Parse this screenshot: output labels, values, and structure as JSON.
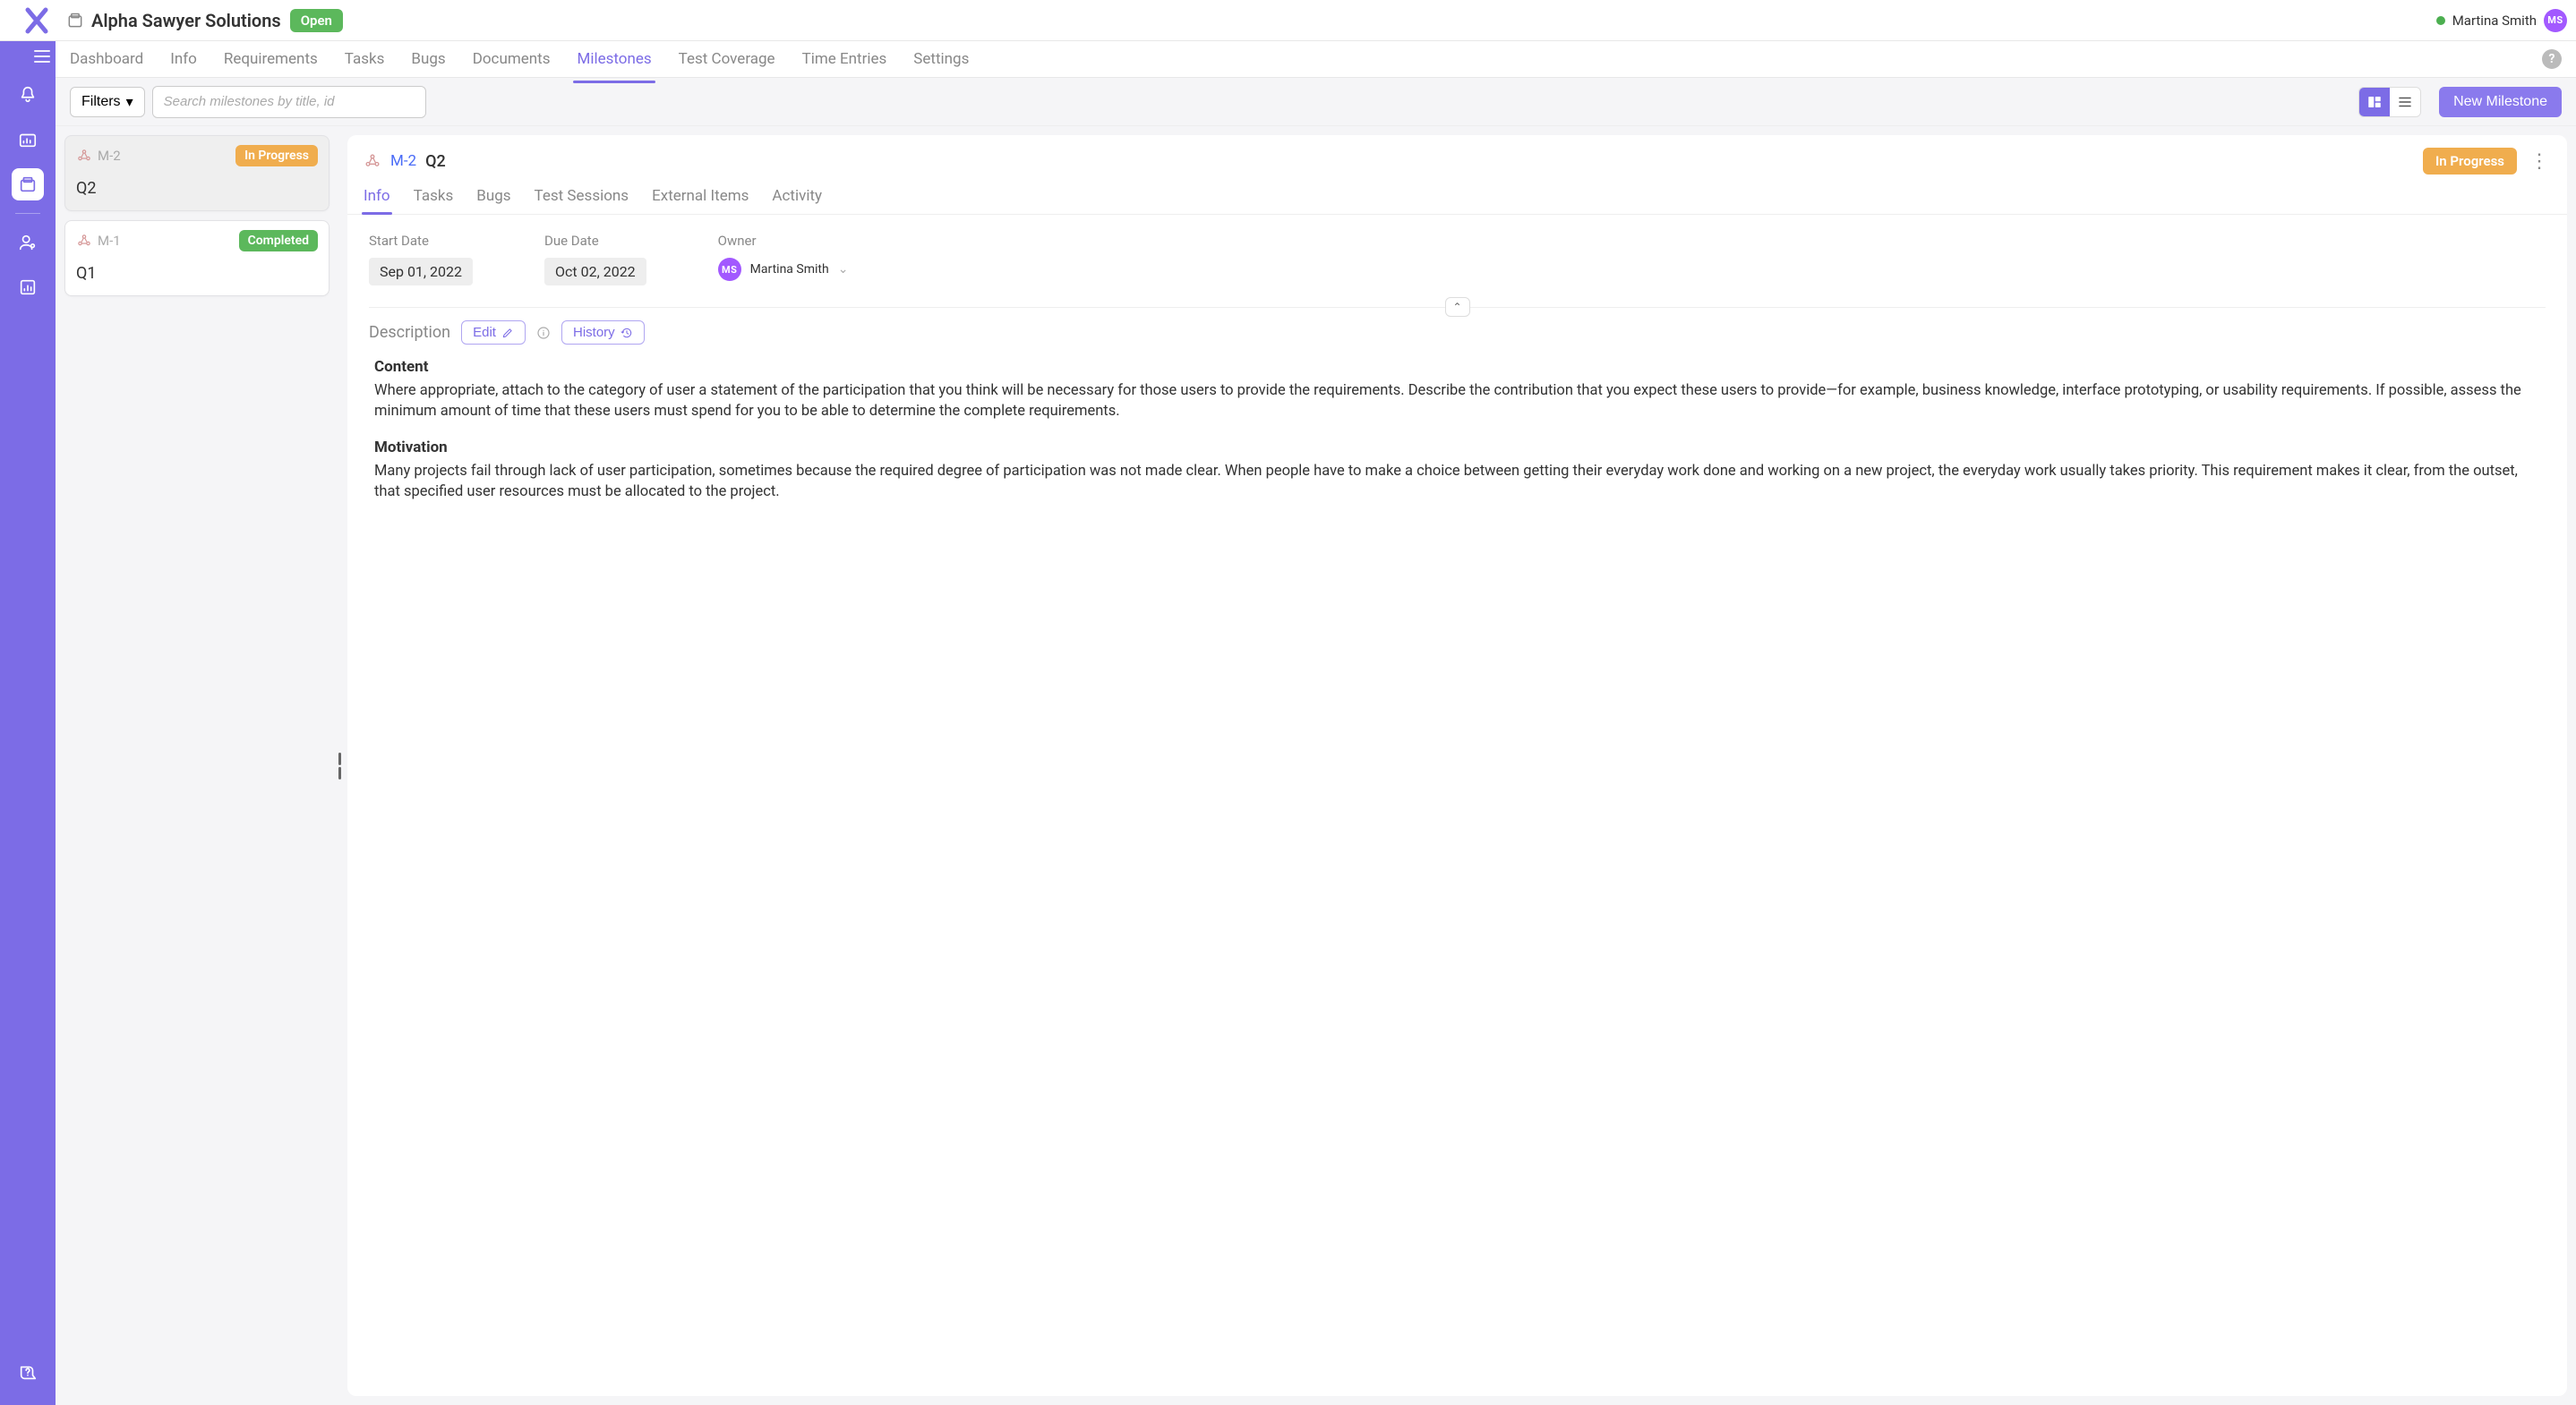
{
  "header": {
    "project_name": "Alpha Sawyer Solutions",
    "project_status": "Open",
    "user_name": "Martina Smith",
    "user_initials": "MS"
  },
  "main_tabs": {
    "items": [
      "Dashboard",
      "Info",
      "Requirements",
      "Tasks",
      "Bugs",
      "Documents",
      "Milestones",
      "Test Coverage",
      "Time Entries",
      "Settings"
    ],
    "active_index": 6
  },
  "toolbar": {
    "filters_label": "Filters",
    "search_placeholder": "Search milestones by title, id",
    "new_button": "New Milestone"
  },
  "milestone_list": [
    {
      "id": "M-2",
      "title": "Q2",
      "status_label": "In Progress",
      "status_kind": "progress",
      "selected": true
    },
    {
      "id": "M-1",
      "title": "Q1",
      "status_label": "Completed",
      "status_kind": "completed",
      "selected": false
    }
  ],
  "detail": {
    "breadcrumb_id": "M-2",
    "breadcrumb_title": "Q2",
    "status_label": "In Progress",
    "tabs": {
      "items": [
        "Info",
        "Tasks",
        "Bugs",
        "Test Sessions",
        "External Items",
        "Activity"
      ],
      "active_index": 0
    },
    "fields": {
      "start_date_label": "Start Date",
      "start_date_value": "Sep 01, 2022",
      "due_date_label": "Due Date",
      "due_date_value": "Oct 02, 2022",
      "owner_label": "Owner",
      "owner_name": "Martina Smith",
      "owner_initials": "MS"
    },
    "description": {
      "section_label": "Description",
      "edit_label": "Edit",
      "history_label": "History",
      "content_heading": "Content",
      "content_body": "Where appropriate, attach to the category of user a statement of the participation that you think will be necessary for those users to provide the requirements. Describe the contribution that you expect these users to provide—for example, business knowledge, interface prototyping, or usability requirements. If possible, assess the minimum amount of time that these users must spend for you to be able to determine the complete requirements.",
      "motivation_heading": "Motivation",
      "motivation_body": "Many projects fail through lack of user participation, sometimes because the required degree of participation was not made clear. When people have to make a choice between getting their everyday work done and working on a new project, the everyday work usually takes priority. This requirement makes it clear, from the outset, that specified user resources must be allocated to the project."
    }
  }
}
